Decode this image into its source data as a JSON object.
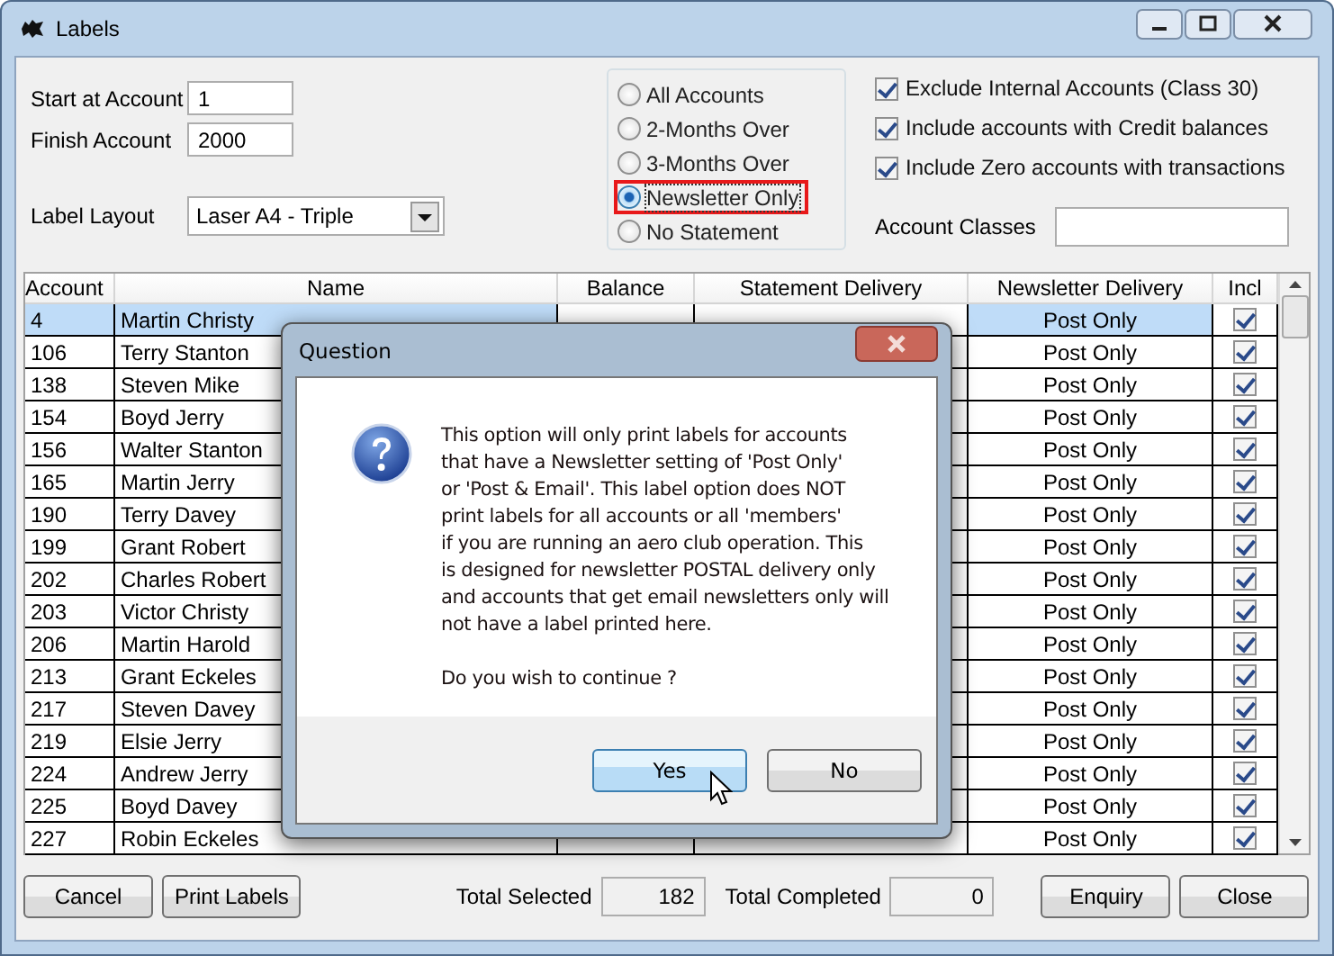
{
  "window": {
    "title": "Labels"
  },
  "range": [
    {
      "label": "Start at Account",
      "value": "1"
    },
    {
      "label": "Finish Account",
      "value": "2000"
    }
  ],
  "layout": {
    "label": "Label Layout",
    "value": "Laser A4 - Triple"
  },
  "radios": [
    {
      "label": "All Accounts",
      "selected": false,
      "highlighted": false
    },
    {
      "label": "2-Months Over",
      "selected": false,
      "highlighted": false
    },
    {
      "label": "3-Months Over",
      "selected": false,
      "highlighted": false
    },
    {
      "label": "Newsletter Only",
      "selected": true,
      "highlighted": true
    },
    {
      "label": "No Statement",
      "selected": false,
      "highlighted": false
    }
  ],
  "checkboxes": [
    {
      "label": "Exclude Internal Accounts (Class 30)",
      "checked": true
    },
    {
      "label": "Include accounts with Credit balances",
      "checked": true
    },
    {
      "label": "Include Zero accounts with transactions",
      "checked": true
    }
  ],
  "account_classes": {
    "label": "Account Classes"
  },
  "table": {
    "columns": [
      "Account",
      "Name",
      "Balance",
      "Statement Delivery",
      "Newsletter Delivery",
      "Incl"
    ],
    "rows": [
      {
        "account": "4",
        "name": "Martin Christy",
        "newsletter": "Post Only",
        "incl": true,
        "selected": true
      },
      {
        "account": "106",
        "name": "Terry Stanton",
        "newsletter": "Post Only",
        "incl": true,
        "selected": false
      },
      {
        "account": "138",
        "name": "Steven Mike",
        "newsletter": "Post Only",
        "incl": true,
        "selected": false
      },
      {
        "account": "154",
        "name": "Boyd Jerry",
        "newsletter": "Post Only",
        "incl": true,
        "selected": false
      },
      {
        "account": "156",
        "name": "Walter Stanton",
        "newsletter": "Post Only",
        "incl": true,
        "selected": false
      },
      {
        "account": "165",
        "name": "Martin Jerry",
        "newsletter": "Post Only",
        "incl": true,
        "selected": false
      },
      {
        "account": "190",
        "name": "Terry Davey",
        "newsletter": "Post Only",
        "incl": true,
        "selected": false
      },
      {
        "account": "199",
        "name": "Grant Robert",
        "newsletter": "Post Only",
        "incl": true,
        "selected": false
      },
      {
        "account": "202",
        "name": "Charles Robert",
        "newsletter": "Post Only",
        "incl": true,
        "selected": false
      },
      {
        "account": "203",
        "name": "Victor Christy",
        "newsletter": "Post Only",
        "incl": true,
        "selected": false
      },
      {
        "account": "206",
        "name": "Martin Harold",
        "newsletter": "Post Only",
        "incl": true,
        "selected": false
      },
      {
        "account": "213",
        "name": "Grant Eckeles",
        "newsletter": "Post Only",
        "incl": true,
        "selected": false
      },
      {
        "account": "217",
        "name": "Steven Davey",
        "newsletter": "Post Only",
        "incl": true,
        "selected": false
      },
      {
        "account": "219",
        "name": "Elsie Jerry",
        "newsletter": "Post Only",
        "incl": true,
        "selected": false
      },
      {
        "account": "224",
        "name": "Andrew Jerry",
        "newsletter": "Post Only",
        "incl": true,
        "selected": false
      },
      {
        "account": "225",
        "name": "Boyd Davey",
        "newsletter": "Post Only",
        "incl": true,
        "selected": false
      },
      {
        "account": "227",
        "name": "Robin Eckeles",
        "newsletter": "Post Only",
        "incl": true,
        "selected": false
      }
    ]
  },
  "footer": {
    "buttons_left": [
      "Cancel",
      "Print Labels"
    ],
    "totals": [
      {
        "label": "Total Selected",
        "value": "182"
      },
      {
        "label": "Total Completed",
        "value": "0"
      }
    ],
    "buttons_right": [
      "Enquiry",
      "Close"
    ]
  },
  "dialog": {
    "title": "Question",
    "message": [
      "This option will only print labels for accounts",
      "that have a Newsletter setting of 'Post Only'",
      "or 'Post & Email'. This label option does NOT",
      "print labels for all accounts or all 'members'",
      "if you are running an aero club operation. This",
      "is designed for newsletter POSTAL delivery only",
      "and accounts that get email newsletters only will",
      "not have a label printed here."
    ],
    "question": "Do you wish to continue ?",
    "buttons": [
      {
        "label": "Yes",
        "selected": true
      },
      {
        "label": "No",
        "selected": false
      }
    ]
  }
}
